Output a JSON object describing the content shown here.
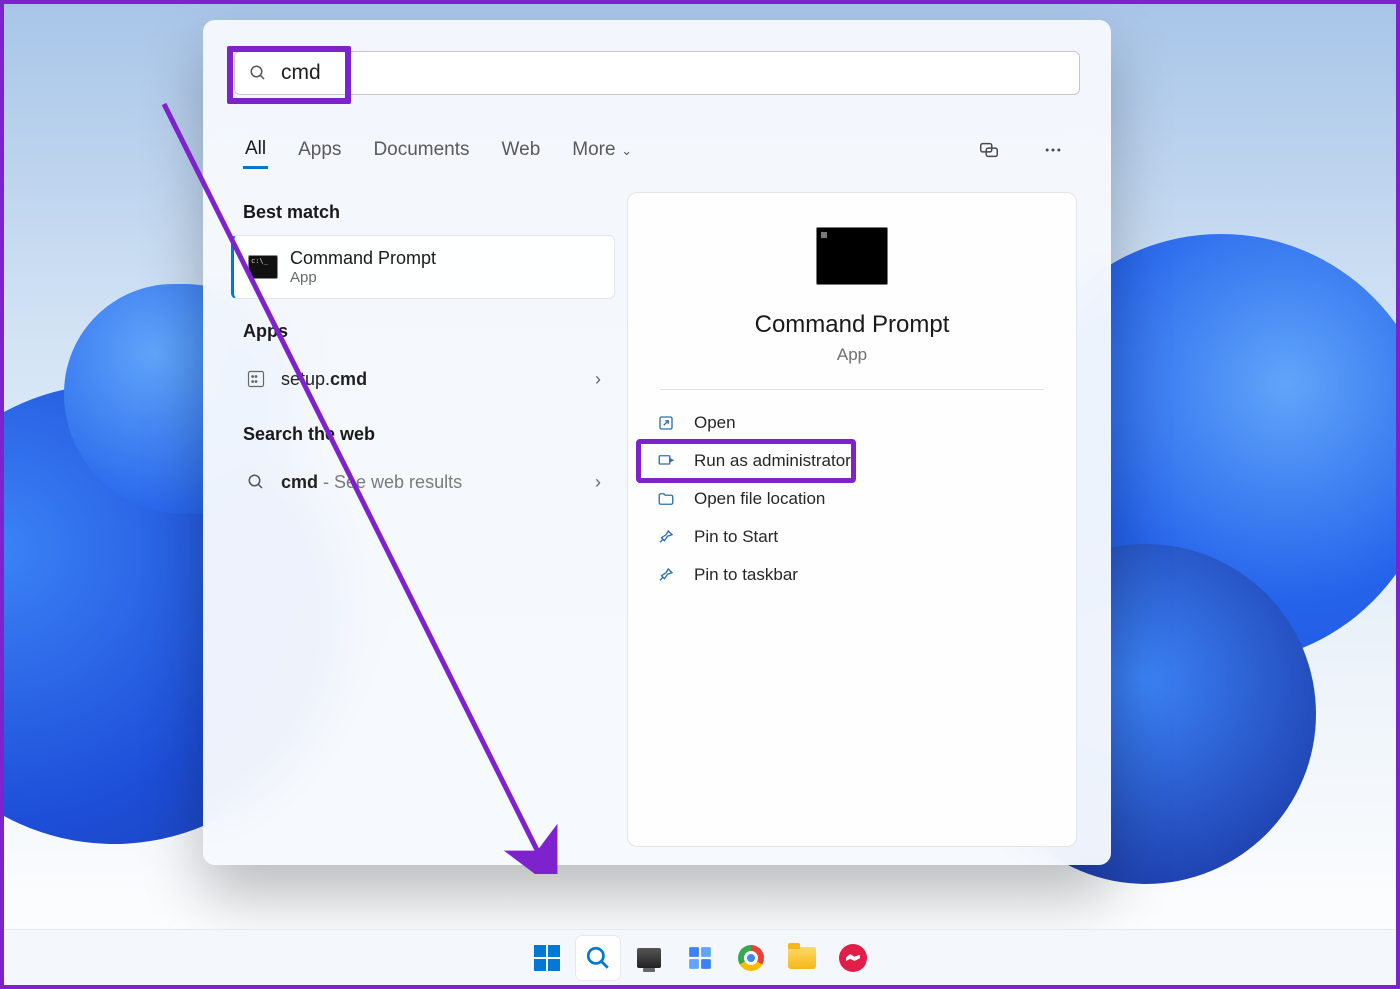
{
  "search": {
    "query": "cmd"
  },
  "tabs": {
    "all": "All",
    "apps": "Apps",
    "documents": "Documents",
    "web": "Web",
    "more": "More"
  },
  "sections": {
    "best_match": "Best match",
    "apps": "Apps",
    "web": "Search the web"
  },
  "best_match": {
    "title": "Command Prompt",
    "subtitle": "App"
  },
  "apps_list": {
    "item0_prefix": "setup.",
    "item0_bold": "cmd"
  },
  "web_list": {
    "item0_term": "cmd",
    "item0_suffix": " - See web results"
  },
  "detail": {
    "title": "Command Prompt",
    "subtitle": "App",
    "actions": {
      "open": "Open",
      "run_admin": "Run as administrator",
      "open_loc": "Open file location",
      "pin_start": "Pin to Start",
      "pin_taskbar": "Pin to taskbar"
    }
  }
}
